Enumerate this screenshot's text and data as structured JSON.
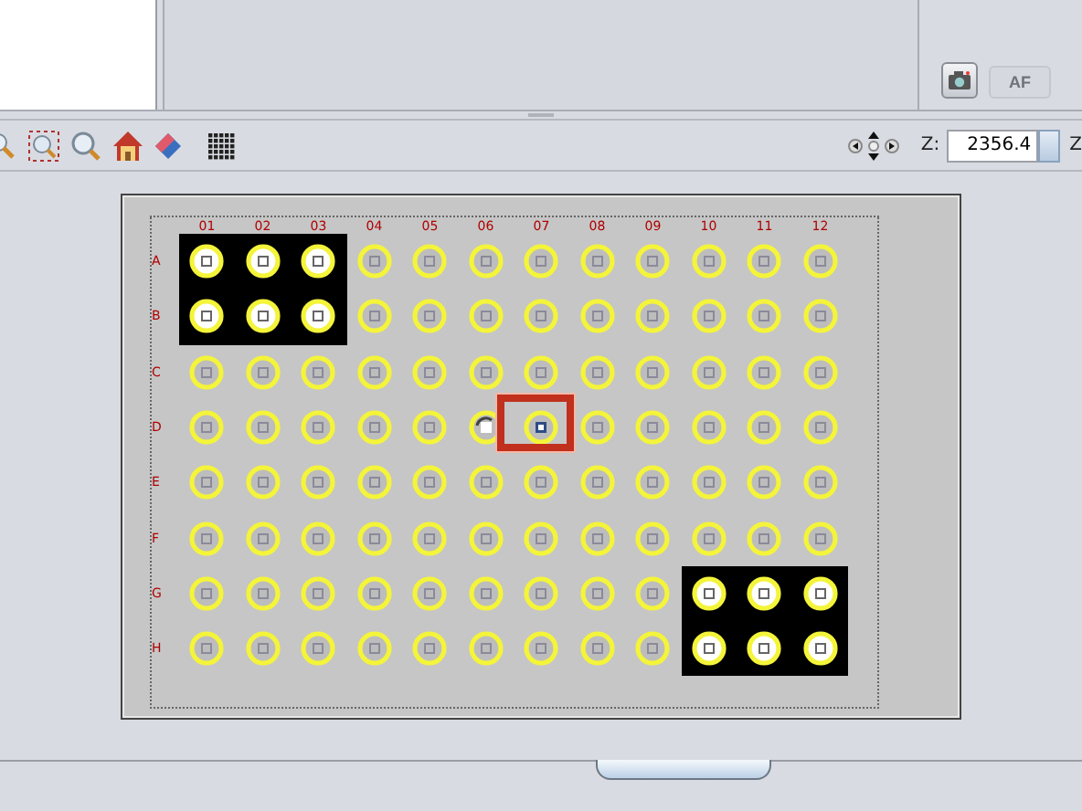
{
  "camera_panel": {
    "snapshot_button": {
      "disabled": false
    },
    "af_button": {
      "label": "AF",
      "disabled": true
    }
  },
  "toolbar": {
    "z_label": "Z:",
    "z_value": "2356.4",
    "z_label_2": "Z"
  },
  "plate": {
    "columns": [
      "01",
      "02",
      "03",
      "04",
      "05",
      "06",
      "07",
      "08",
      "09",
      "10",
      "11",
      "12"
    ],
    "rows": [
      {
        "label": "A",
        "wells": [
          {
            "kind": "imaged",
            "selected": false
          },
          {
            "kind": "imaged",
            "selected": false
          },
          {
            "kind": "imaged",
            "selected": false
          },
          {
            "kind": "empty",
            "selected": false
          },
          {
            "kind": "empty",
            "selected": false
          },
          {
            "kind": "empty",
            "selected": false
          },
          {
            "kind": "empty",
            "selected": false
          },
          {
            "kind": "empty",
            "selected": false
          },
          {
            "kind": "empty",
            "selected": false
          },
          {
            "kind": "empty",
            "selected": false
          },
          {
            "kind": "empty",
            "selected": false
          },
          {
            "kind": "empty",
            "selected": false
          }
        ]
      },
      {
        "label": "B",
        "wells": [
          {
            "kind": "imaged",
            "selected": false
          },
          {
            "kind": "imaged",
            "selected": false
          },
          {
            "kind": "imaged",
            "selected": false
          },
          {
            "kind": "empty",
            "selected": false
          },
          {
            "kind": "empty",
            "selected": false
          },
          {
            "kind": "empty",
            "selected": false
          },
          {
            "kind": "empty",
            "selected": false
          },
          {
            "kind": "empty",
            "selected": false
          },
          {
            "kind": "empty",
            "selected": false
          },
          {
            "kind": "empty",
            "selected": false
          },
          {
            "kind": "empty",
            "selected": false
          },
          {
            "kind": "empty",
            "selected": false
          }
        ]
      },
      {
        "label": "C",
        "wells": [
          {
            "kind": "empty",
            "selected": false
          },
          {
            "kind": "empty",
            "selected": false
          },
          {
            "kind": "empty",
            "selected": false
          },
          {
            "kind": "empty",
            "selected": false
          },
          {
            "kind": "empty",
            "selected": false
          },
          {
            "kind": "empty",
            "selected": false
          },
          {
            "kind": "empty",
            "selected": false
          },
          {
            "kind": "empty",
            "selected": false
          },
          {
            "kind": "empty",
            "selected": false
          },
          {
            "kind": "empty",
            "selected": false
          },
          {
            "kind": "empty",
            "selected": false
          },
          {
            "kind": "empty",
            "selected": false
          }
        ]
      },
      {
        "label": "D",
        "wells": [
          {
            "kind": "empty",
            "selected": false
          },
          {
            "kind": "empty",
            "selected": false
          },
          {
            "kind": "empty",
            "selected": false
          },
          {
            "kind": "empty",
            "selected": false
          },
          {
            "kind": "empty",
            "selected": false
          },
          {
            "kind": "visited",
            "selected": false
          },
          {
            "kind": "current",
            "selected": true
          },
          {
            "kind": "empty",
            "selected": false
          },
          {
            "kind": "empty",
            "selected": false
          },
          {
            "kind": "empty",
            "selected": false
          },
          {
            "kind": "empty",
            "selected": false
          },
          {
            "kind": "empty",
            "selected": false
          }
        ]
      },
      {
        "label": "E",
        "wells": [
          {
            "kind": "empty",
            "selected": false
          },
          {
            "kind": "empty",
            "selected": false
          },
          {
            "kind": "empty",
            "selected": false
          },
          {
            "kind": "empty",
            "selected": false
          },
          {
            "kind": "empty",
            "selected": false
          },
          {
            "kind": "empty",
            "selected": false
          },
          {
            "kind": "empty",
            "selected": false
          },
          {
            "kind": "empty",
            "selected": false
          },
          {
            "kind": "empty",
            "selected": false
          },
          {
            "kind": "empty",
            "selected": false
          },
          {
            "kind": "empty",
            "selected": false
          },
          {
            "kind": "empty",
            "selected": false
          }
        ]
      },
      {
        "label": "F",
        "wells": [
          {
            "kind": "empty",
            "selected": false
          },
          {
            "kind": "empty",
            "selected": false
          },
          {
            "kind": "empty",
            "selected": false
          },
          {
            "kind": "empty",
            "selected": false
          },
          {
            "kind": "empty",
            "selected": false
          },
          {
            "kind": "empty",
            "selected": false
          },
          {
            "kind": "empty",
            "selected": false
          },
          {
            "kind": "empty",
            "selected": false
          },
          {
            "kind": "empty",
            "selected": false
          },
          {
            "kind": "empty",
            "selected": false
          },
          {
            "kind": "empty",
            "selected": false
          },
          {
            "kind": "empty",
            "selected": false
          }
        ]
      },
      {
        "label": "G",
        "wells": [
          {
            "kind": "empty",
            "selected": false
          },
          {
            "kind": "empty",
            "selected": false
          },
          {
            "kind": "empty",
            "selected": false
          },
          {
            "kind": "empty",
            "selected": false
          },
          {
            "kind": "empty",
            "selected": false
          },
          {
            "kind": "empty",
            "selected": false
          },
          {
            "kind": "empty",
            "selected": false
          },
          {
            "kind": "empty",
            "selected": false
          },
          {
            "kind": "empty",
            "selected": false
          },
          {
            "kind": "imaged",
            "selected": false
          },
          {
            "kind": "imaged",
            "selected": false
          },
          {
            "kind": "imaged",
            "selected": false
          }
        ]
      },
      {
        "label": "H",
        "wells": [
          {
            "kind": "empty",
            "selected": false
          },
          {
            "kind": "empty",
            "selected": false
          },
          {
            "kind": "empty",
            "selected": false
          },
          {
            "kind": "empty",
            "selected": false
          },
          {
            "kind": "empty",
            "selected": false
          },
          {
            "kind": "empty",
            "selected": false
          },
          {
            "kind": "empty",
            "selected": false
          },
          {
            "kind": "empty",
            "selected": false
          },
          {
            "kind": "empty",
            "selected": false
          },
          {
            "kind": "imaged",
            "selected": false
          },
          {
            "kind": "imaged",
            "selected": false
          },
          {
            "kind": "imaged",
            "selected": false
          }
        ]
      }
    ]
  }
}
